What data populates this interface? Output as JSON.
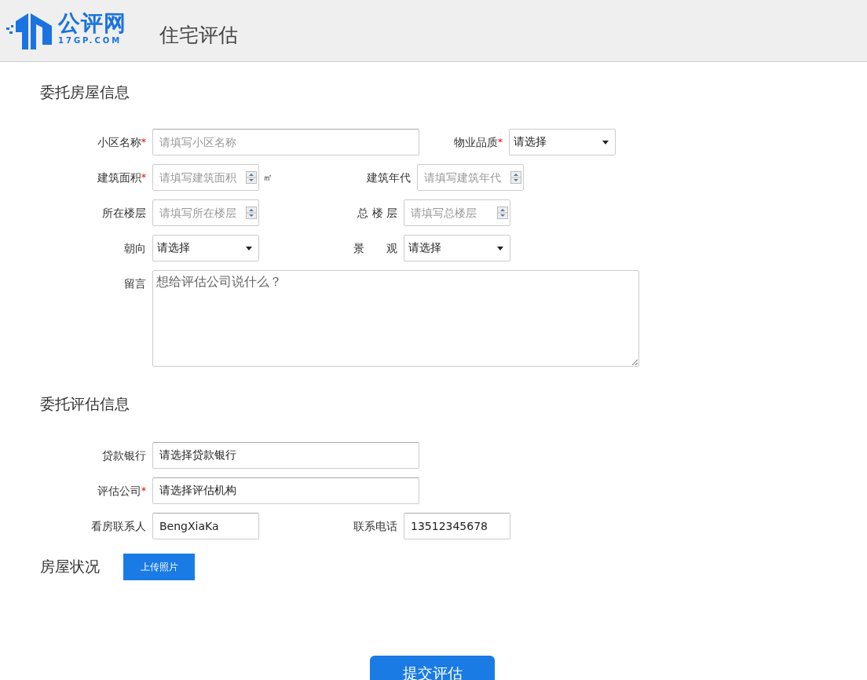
{
  "header": {
    "logo_name": "公评网",
    "logo_domain": "17GP.COM",
    "title": "住宅评估"
  },
  "sections": [
    {
      "title": "委托房屋信息",
      "rows": [
        {
          "fields": [
            {
              "label": "小区名称",
              "required_mark": "*",
              "kind": "input",
              "placeholder": "请填写小区名称"
            },
            {
              "label": "物业品质",
              "required_mark": "*",
              "kind": "select",
              "value": "请选择"
            }
          ]
        },
        {
          "fields": [
            {
              "label": "建筑面积",
              "required_mark": "*",
              "kind": "number",
              "placeholder": "请填写建筑面积",
              "unit": "㎡"
            },
            {
              "label": "建筑年代",
              "kind": "number",
              "placeholder": "请填写建筑年代"
            }
          ]
        },
        {
          "fields": [
            {
              "label": "所在楼层",
              "kind": "number",
              "placeholder": "请填写所在楼层"
            },
            {
              "label": "总 楼 层",
              "kind": "number",
              "placeholder": "请填写总楼层"
            }
          ]
        },
        {
          "fields": [
            {
              "label": "朝向",
              "kind": "select",
              "value": "请选择"
            },
            {
              "label": "景　　观",
              "kind": "select",
              "value": "请选择"
            }
          ]
        },
        {
          "fields": [
            {
              "label": "留言",
              "kind": "textarea",
              "placeholder": "想给评估公司说什么？"
            }
          ]
        }
      ]
    },
    {
      "title": "委托评估信息",
      "rows": [
        {
          "fields": [
            {
              "label": "贷款银行",
              "kind": "input",
              "value": "请选择贷款银行"
            }
          ]
        },
        {
          "fields": [
            {
              "label": "评估公司",
              "required_mark": "*",
              "kind": "input",
              "value": "请选择评估机构"
            }
          ]
        },
        {
          "fields": [
            {
              "label": "看房联系人",
              "kind": "short-input",
              "value": "BengXiaKa"
            },
            {
              "label": "联系电话",
              "kind": "short-input",
              "value": "13512345678"
            }
          ]
        }
      ]
    }
  ],
  "photos": {
    "title": "房屋状况",
    "button": "上传照片"
  },
  "submit": "提交评估"
}
